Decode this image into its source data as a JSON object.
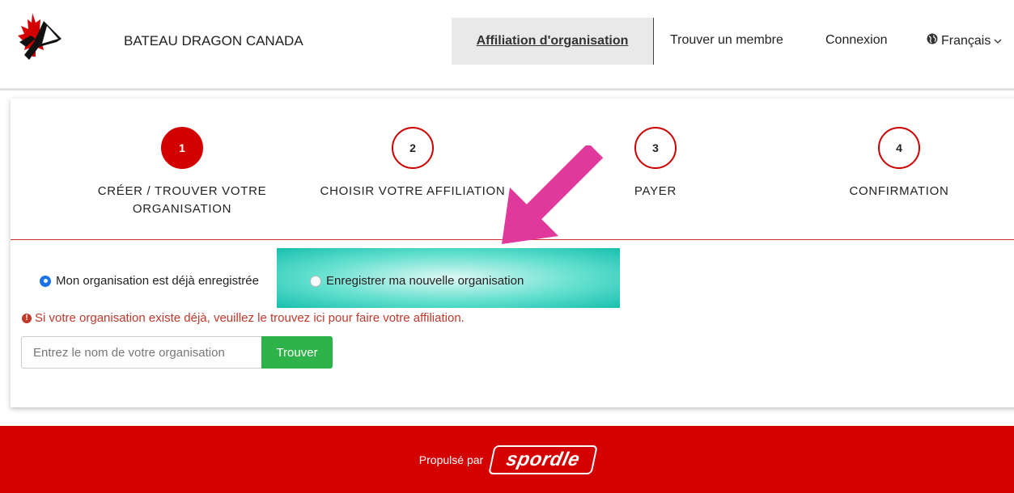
{
  "header": {
    "site_title": "BATEAU DRAGON CANADA",
    "nav": {
      "active": "Affiliation d'organisation",
      "find_member": "Trouver un membre",
      "login": "Connexion",
      "language": "Français",
      "language_icon": "globe-icon",
      "dropdown_icon": "chevron-down-icon"
    }
  },
  "steps": [
    {
      "number": "1",
      "label": "CRÉER / TROUVER VOTRE ORGANISATION",
      "state": "active"
    },
    {
      "number": "2",
      "label": "CHOISIR VOTRE AFFILIATION",
      "state": "todo"
    },
    {
      "number": "3",
      "label": "PAYER",
      "state": "todo"
    },
    {
      "number": "4",
      "label": "CONFIRMATION",
      "state": "todo"
    }
  ],
  "form": {
    "option_existing": "Mon organisation est déjà enregistrée",
    "option_new": "Enregistrer ma nouvelle organisation",
    "warning": "Si votre organisation existe déjà, veuillez le trouvez ici pour faire votre affiliation.",
    "warning_icon": "exclamation-circle-icon",
    "search_placeholder": "Entrez le nom de votre organisation",
    "search_button": "Trouver"
  },
  "footer": {
    "powered_by": "Propulsé par",
    "brand": "spordle"
  },
  "colors": {
    "brand_red": "#d40000",
    "step_active": "#d30000",
    "button_green": "#2db34a",
    "warning_red": "#c0392b",
    "highlight_teal": "#18bfae",
    "arrow_pink": "#e0399b",
    "radio_blue": "#1a73e8"
  }
}
